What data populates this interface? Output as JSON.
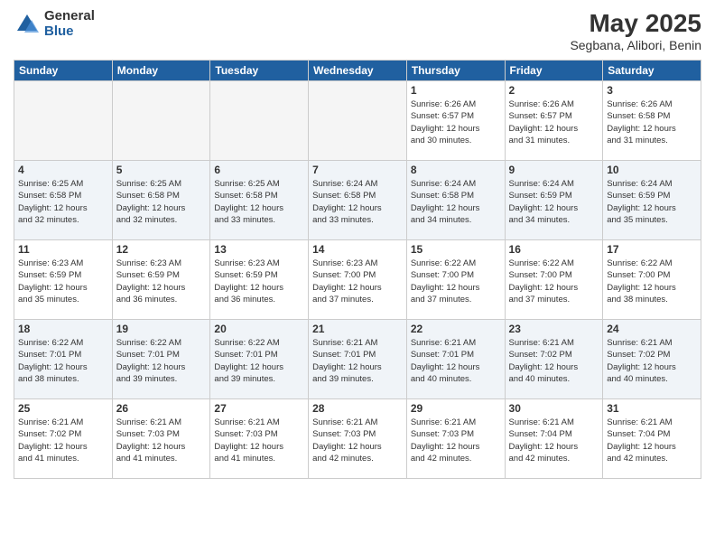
{
  "logo": {
    "general": "General",
    "blue": "Blue"
  },
  "title": "May 2025",
  "location": "Segbana, Alibori, Benin",
  "days_of_week": [
    "Sunday",
    "Monday",
    "Tuesday",
    "Wednesday",
    "Thursday",
    "Friday",
    "Saturday"
  ],
  "weeks": [
    [
      {
        "day": "",
        "info": ""
      },
      {
        "day": "",
        "info": ""
      },
      {
        "day": "",
        "info": ""
      },
      {
        "day": "",
        "info": ""
      },
      {
        "day": "1",
        "info": "Sunrise: 6:26 AM\nSunset: 6:57 PM\nDaylight: 12 hours\nand 30 minutes."
      },
      {
        "day": "2",
        "info": "Sunrise: 6:26 AM\nSunset: 6:57 PM\nDaylight: 12 hours\nand 31 minutes."
      },
      {
        "day": "3",
        "info": "Sunrise: 6:26 AM\nSunset: 6:58 PM\nDaylight: 12 hours\nand 31 minutes."
      }
    ],
    [
      {
        "day": "4",
        "info": "Sunrise: 6:25 AM\nSunset: 6:58 PM\nDaylight: 12 hours\nand 32 minutes."
      },
      {
        "day": "5",
        "info": "Sunrise: 6:25 AM\nSunset: 6:58 PM\nDaylight: 12 hours\nand 32 minutes."
      },
      {
        "day": "6",
        "info": "Sunrise: 6:25 AM\nSunset: 6:58 PM\nDaylight: 12 hours\nand 33 minutes."
      },
      {
        "day": "7",
        "info": "Sunrise: 6:24 AM\nSunset: 6:58 PM\nDaylight: 12 hours\nand 33 minutes."
      },
      {
        "day": "8",
        "info": "Sunrise: 6:24 AM\nSunset: 6:58 PM\nDaylight: 12 hours\nand 34 minutes."
      },
      {
        "day": "9",
        "info": "Sunrise: 6:24 AM\nSunset: 6:59 PM\nDaylight: 12 hours\nand 34 minutes."
      },
      {
        "day": "10",
        "info": "Sunrise: 6:24 AM\nSunset: 6:59 PM\nDaylight: 12 hours\nand 35 minutes."
      }
    ],
    [
      {
        "day": "11",
        "info": "Sunrise: 6:23 AM\nSunset: 6:59 PM\nDaylight: 12 hours\nand 35 minutes."
      },
      {
        "day": "12",
        "info": "Sunrise: 6:23 AM\nSunset: 6:59 PM\nDaylight: 12 hours\nand 36 minutes."
      },
      {
        "day": "13",
        "info": "Sunrise: 6:23 AM\nSunset: 6:59 PM\nDaylight: 12 hours\nand 36 minutes."
      },
      {
        "day": "14",
        "info": "Sunrise: 6:23 AM\nSunset: 7:00 PM\nDaylight: 12 hours\nand 37 minutes."
      },
      {
        "day": "15",
        "info": "Sunrise: 6:22 AM\nSunset: 7:00 PM\nDaylight: 12 hours\nand 37 minutes."
      },
      {
        "day": "16",
        "info": "Sunrise: 6:22 AM\nSunset: 7:00 PM\nDaylight: 12 hours\nand 37 minutes."
      },
      {
        "day": "17",
        "info": "Sunrise: 6:22 AM\nSunset: 7:00 PM\nDaylight: 12 hours\nand 38 minutes."
      }
    ],
    [
      {
        "day": "18",
        "info": "Sunrise: 6:22 AM\nSunset: 7:01 PM\nDaylight: 12 hours\nand 38 minutes."
      },
      {
        "day": "19",
        "info": "Sunrise: 6:22 AM\nSunset: 7:01 PM\nDaylight: 12 hours\nand 39 minutes."
      },
      {
        "day": "20",
        "info": "Sunrise: 6:22 AM\nSunset: 7:01 PM\nDaylight: 12 hours\nand 39 minutes."
      },
      {
        "day": "21",
        "info": "Sunrise: 6:21 AM\nSunset: 7:01 PM\nDaylight: 12 hours\nand 39 minutes."
      },
      {
        "day": "22",
        "info": "Sunrise: 6:21 AM\nSunset: 7:01 PM\nDaylight: 12 hours\nand 40 minutes."
      },
      {
        "day": "23",
        "info": "Sunrise: 6:21 AM\nSunset: 7:02 PM\nDaylight: 12 hours\nand 40 minutes."
      },
      {
        "day": "24",
        "info": "Sunrise: 6:21 AM\nSunset: 7:02 PM\nDaylight: 12 hours\nand 40 minutes."
      }
    ],
    [
      {
        "day": "25",
        "info": "Sunrise: 6:21 AM\nSunset: 7:02 PM\nDaylight: 12 hours\nand 41 minutes."
      },
      {
        "day": "26",
        "info": "Sunrise: 6:21 AM\nSunset: 7:03 PM\nDaylight: 12 hours\nand 41 minutes."
      },
      {
        "day": "27",
        "info": "Sunrise: 6:21 AM\nSunset: 7:03 PM\nDaylight: 12 hours\nand 41 minutes."
      },
      {
        "day": "28",
        "info": "Sunrise: 6:21 AM\nSunset: 7:03 PM\nDaylight: 12 hours\nand 42 minutes."
      },
      {
        "day": "29",
        "info": "Sunrise: 6:21 AM\nSunset: 7:03 PM\nDaylight: 12 hours\nand 42 minutes."
      },
      {
        "day": "30",
        "info": "Sunrise: 6:21 AM\nSunset: 7:04 PM\nDaylight: 12 hours\nand 42 minutes."
      },
      {
        "day": "31",
        "info": "Sunrise: 6:21 AM\nSunset: 7:04 PM\nDaylight: 12 hours\nand 42 minutes."
      }
    ]
  ]
}
